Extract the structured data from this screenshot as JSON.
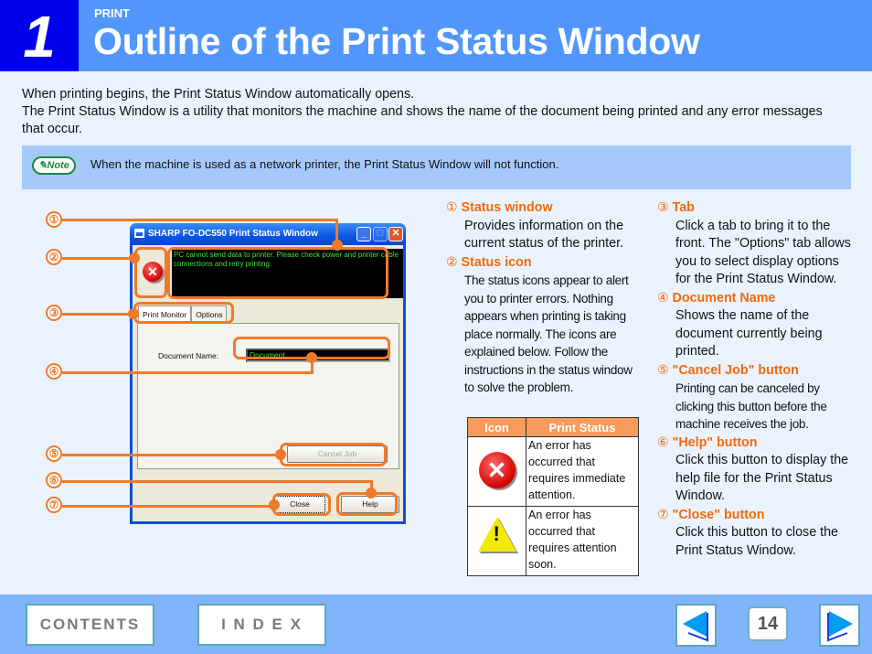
{
  "header": {
    "chapter_number": "1",
    "section": "PRINT",
    "title": "Outline of the Print Status Window"
  },
  "intro": {
    "line1": "When printing begins, the Print Status Window automatically opens.",
    "line2": "The Print Status Window is a utility that monitors the machine and shows the name of the document being printed and any error messages that occur."
  },
  "note": {
    "badge": "Note",
    "text": "When the machine is used as a network printer, the Print Status Window will not function."
  },
  "callouts": [
    "①",
    "②",
    "③",
    "④",
    "⑤",
    "⑥",
    "⑦"
  ],
  "dialog": {
    "title": "SHARP FO-DC550 Print Status Window",
    "status_message": "PC cannot send data to printer. Please check power and printer cable connections and retry printing.",
    "tabs": [
      "Print Monitor",
      "Options"
    ],
    "document_label": "Document Name:",
    "document_value": "Document",
    "cancel_label": "Cancel Job",
    "close_label": "Close",
    "help_label": "Help"
  },
  "descriptions": [
    {
      "num": "①",
      "heading": "Status window",
      "text": "Provides information on the current status of the printer."
    },
    {
      "num": "②",
      "heading": "Status icon",
      "text": "The status icons appear to alert you to printer errors. Nothing appears when printing is taking place normally. The icons are explained below. Follow the instructions in the status window to solve the problem."
    },
    {
      "num": "③",
      "heading": "Tab",
      "text": "Click a tab to bring it to the front. The \"Options\" tab allows you to select display options for the Print Status Window."
    },
    {
      "num": "④",
      "heading": "Document Name",
      "text": "Shows the name of the document currently being printed."
    },
    {
      "num": "⑤",
      "heading": "\"Cancel Job\" button",
      "text": "Printing can be canceled by clicking this button before the machine receives the job."
    },
    {
      "num": "⑥",
      "heading": "\"Help\" button",
      "text": "Click this button to display the help file for the Print Status Window."
    },
    {
      "num": "⑦",
      "heading": "\"Close\" button",
      "text": "Click this button to close the Print Status Window."
    }
  ],
  "status_table": {
    "headers": [
      "Icon",
      "Print Status"
    ],
    "rows": [
      {
        "icon": "error-icon",
        "text": "An error has occurred that requires immediate attention."
      },
      {
        "icon": "warning-icon",
        "text": "An error has occurred that requires attention soon."
      }
    ]
  },
  "footer": {
    "contents_label": "CONTENTS",
    "index_label": "I N D E X",
    "page_number": "14"
  },
  "colors": {
    "header_blue": "#5096fb",
    "chapter_blue": "#0000ee",
    "accent_orange": "#f07a2a",
    "note_bg": "#a6c9fb",
    "footer_blue": "#80b5fc"
  }
}
